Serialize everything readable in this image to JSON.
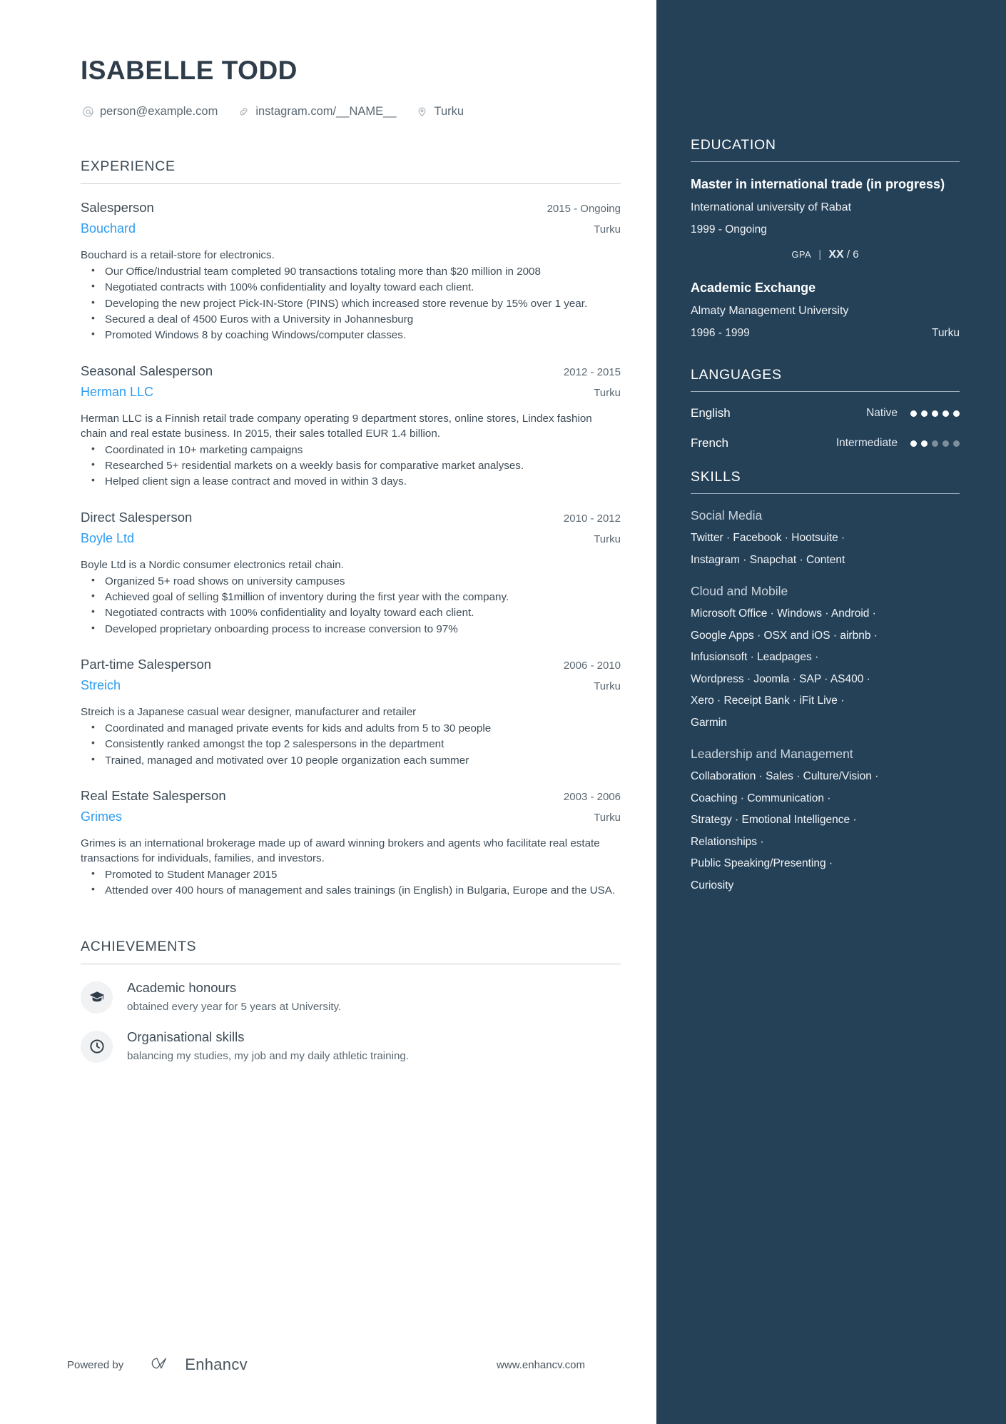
{
  "header": {
    "name": "ISABELLE TODD",
    "contacts": [
      {
        "icon": "at-icon",
        "text": "person@example.com"
      },
      {
        "icon": "link-icon",
        "text": "instagram.com/__NAME__"
      },
      {
        "icon": "location-pin-icon",
        "text": "Turku"
      }
    ]
  },
  "experience": {
    "title": "EXPERIENCE",
    "jobs": [
      {
        "title": "Salesperson",
        "dates": "2015 - Ongoing",
        "company": "Bouchard",
        "location": "Turku",
        "description": "Bouchard is a retail-store for electronics.",
        "bullets": [
          "Our Office/Industrial team completed 90 transactions totaling more than $20 million in 2008",
          "Negotiated contracts with 100% confidentiality and loyalty toward each client.",
          "Developing the new project Pick-IN-Store (PINS) which increased store revenue by 15% over 1 year.",
          "Secured a deal of 4500 Euros with a University in Johannesburg",
          "Promoted Windows 8 by coaching Windows/computer classes."
        ]
      },
      {
        "title": "Seasonal Salesperson",
        "dates": "2012 - 2015",
        "company": "Herman LLC",
        "location": "Turku",
        "description": "Herman LLC is a Finnish retail trade company operating 9 department stores, online stores, Lindex fashion chain and real estate business. In 2015, their sales totalled EUR 1.4 billion.",
        "bullets": [
          "Coordinated in 10+ marketing campaigns",
          "Researched 5+ residential markets on a weekly basis for comparative market analyses.",
          "Helped client sign a lease contract and moved in within 3 days."
        ]
      },
      {
        "title": "Direct Salesperson",
        "dates": "2010 - 2012",
        "company": "Boyle Ltd",
        "location": "Turku",
        "description": "Boyle Ltd is a Nordic consumer electronics retail chain.",
        "bullets": [
          "Organized 5+ road shows on university campuses",
          "Achieved goal of selling $1million of inventory during the first year with the company.",
          "Negotiated contracts with 100% confidentiality and loyalty toward each client.",
          "Developed proprietary onboarding process to increase conversion to 97%"
        ]
      },
      {
        "title": "Part-time Salesperson",
        "dates": "2006 - 2010",
        "company": "Streich",
        "location": "Turku",
        "description": "Streich is a Japanese casual wear designer, manufacturer and retailer",
        "bullets": [
          "Coordinated and managed private events for kids and adults from 5 to 30 people",
          "Consistently ranked amongst the top 2 salespersons in the department",
          "Trained, managed and motivated over 10 people organization each summer"
        ]
      },
      {
        "title": "Real Estate Salesperson",
        "dates": "2003 - 2006",
        "company": "Grimes",
        "location": "Turku",
        "description": "Grimes is an international brokerage made up of award winning brokers and agents who facilitate real estate transactions for individuals, families, and investors.",
        "bullets": [
          "Promoted to Student Manager 2015",
          "Attended over 400 hours of management and sales trainings (in English) in Bulgaria, Europe and the USA."
        ]
      }
    ]
  },
  "achievements": {
    "title": "ACHIEVEMENTS",
    "items": [
      {
        "icon": "graduation-cap-icon",
        "title": "Academic honours",
        "subtitle": "obtained every year for 5 years at University."
      },
      {
        "icon": "clock-icon",
        "title": "Organisational skills",
        "subtitle": "balancing my studies, my job and my daily athletic training."
      }
    ]
  },
  "footer": {
    "powered_by": "Powered by",
    "brand": "Enhancv",
    "website": "www.enhancv.com"
  },
  "education": {
    "title": "EDUCATION",
    "entries": [
      {
        "degree": "Master in international trade (in progress)",
        "school": "International university of Rabat",
        "dates": "1999 - Ongoing",
        "location": "",
        "gpa_label": "GPA",
        "gpa_value": "XX",
        "gpa_max": "/ 6"
      },
      {
        "degree": "Academic Exchange",
        "school": "Almaty Management University",
        "dates": "1996 - 1999",
        "location": "Turku"
      }
    ]
  },
  "languages": {
    "title": "LANGUAGES",
    "items": [
      {
        "name": "English",
        "level": "Native",
        "filled": 5,
        "total": 5
      },
      {
        "name": "French",
        "level": "Intermediate",
        "filled": 2,
        "total": 5
      }
    ]
  },
  "skills": {
    "title": "SKILLS",
    "groups": [
      {
        "name": "Social Media",
        "lines": [
          "Twitter · Facebook · Hootsuite ·",
          "Instagram · Snapchat · Content"
        ]
      },
      {
        "name": "Cloud and Mobile",
        "lines": [
          "Microsoft Office · Windows · Android ·",
          "Google Apps · OSX and iOS · airbnb ·",
          "Infusionsoft · Leadpages ·",
          "Wordpress · Joomla · SAP · AS400 ·",
          "Xero · Receipt Bank · iFit Live ·",
          "Garmin"
        ]
      },
      {
        "name": "Leadership and Management",
        "lines": [
          "Collaboration · Sales · Culture/Vision ·",
          "Coaching · Communication ·",
          "Strategy · Emotional Intelligence ·",
          "Relationships ·",
          "Public Speaking/Presenting ·",
          "Curiosity"
        ]
      }
    ]
  },
  "colors": {
    "sidebar_bg": "#254158",
    "accent_link": "#2d9cf0",
    "heading": "#3c4a55",
    "body_text": "#3f4d58"
  }
}
